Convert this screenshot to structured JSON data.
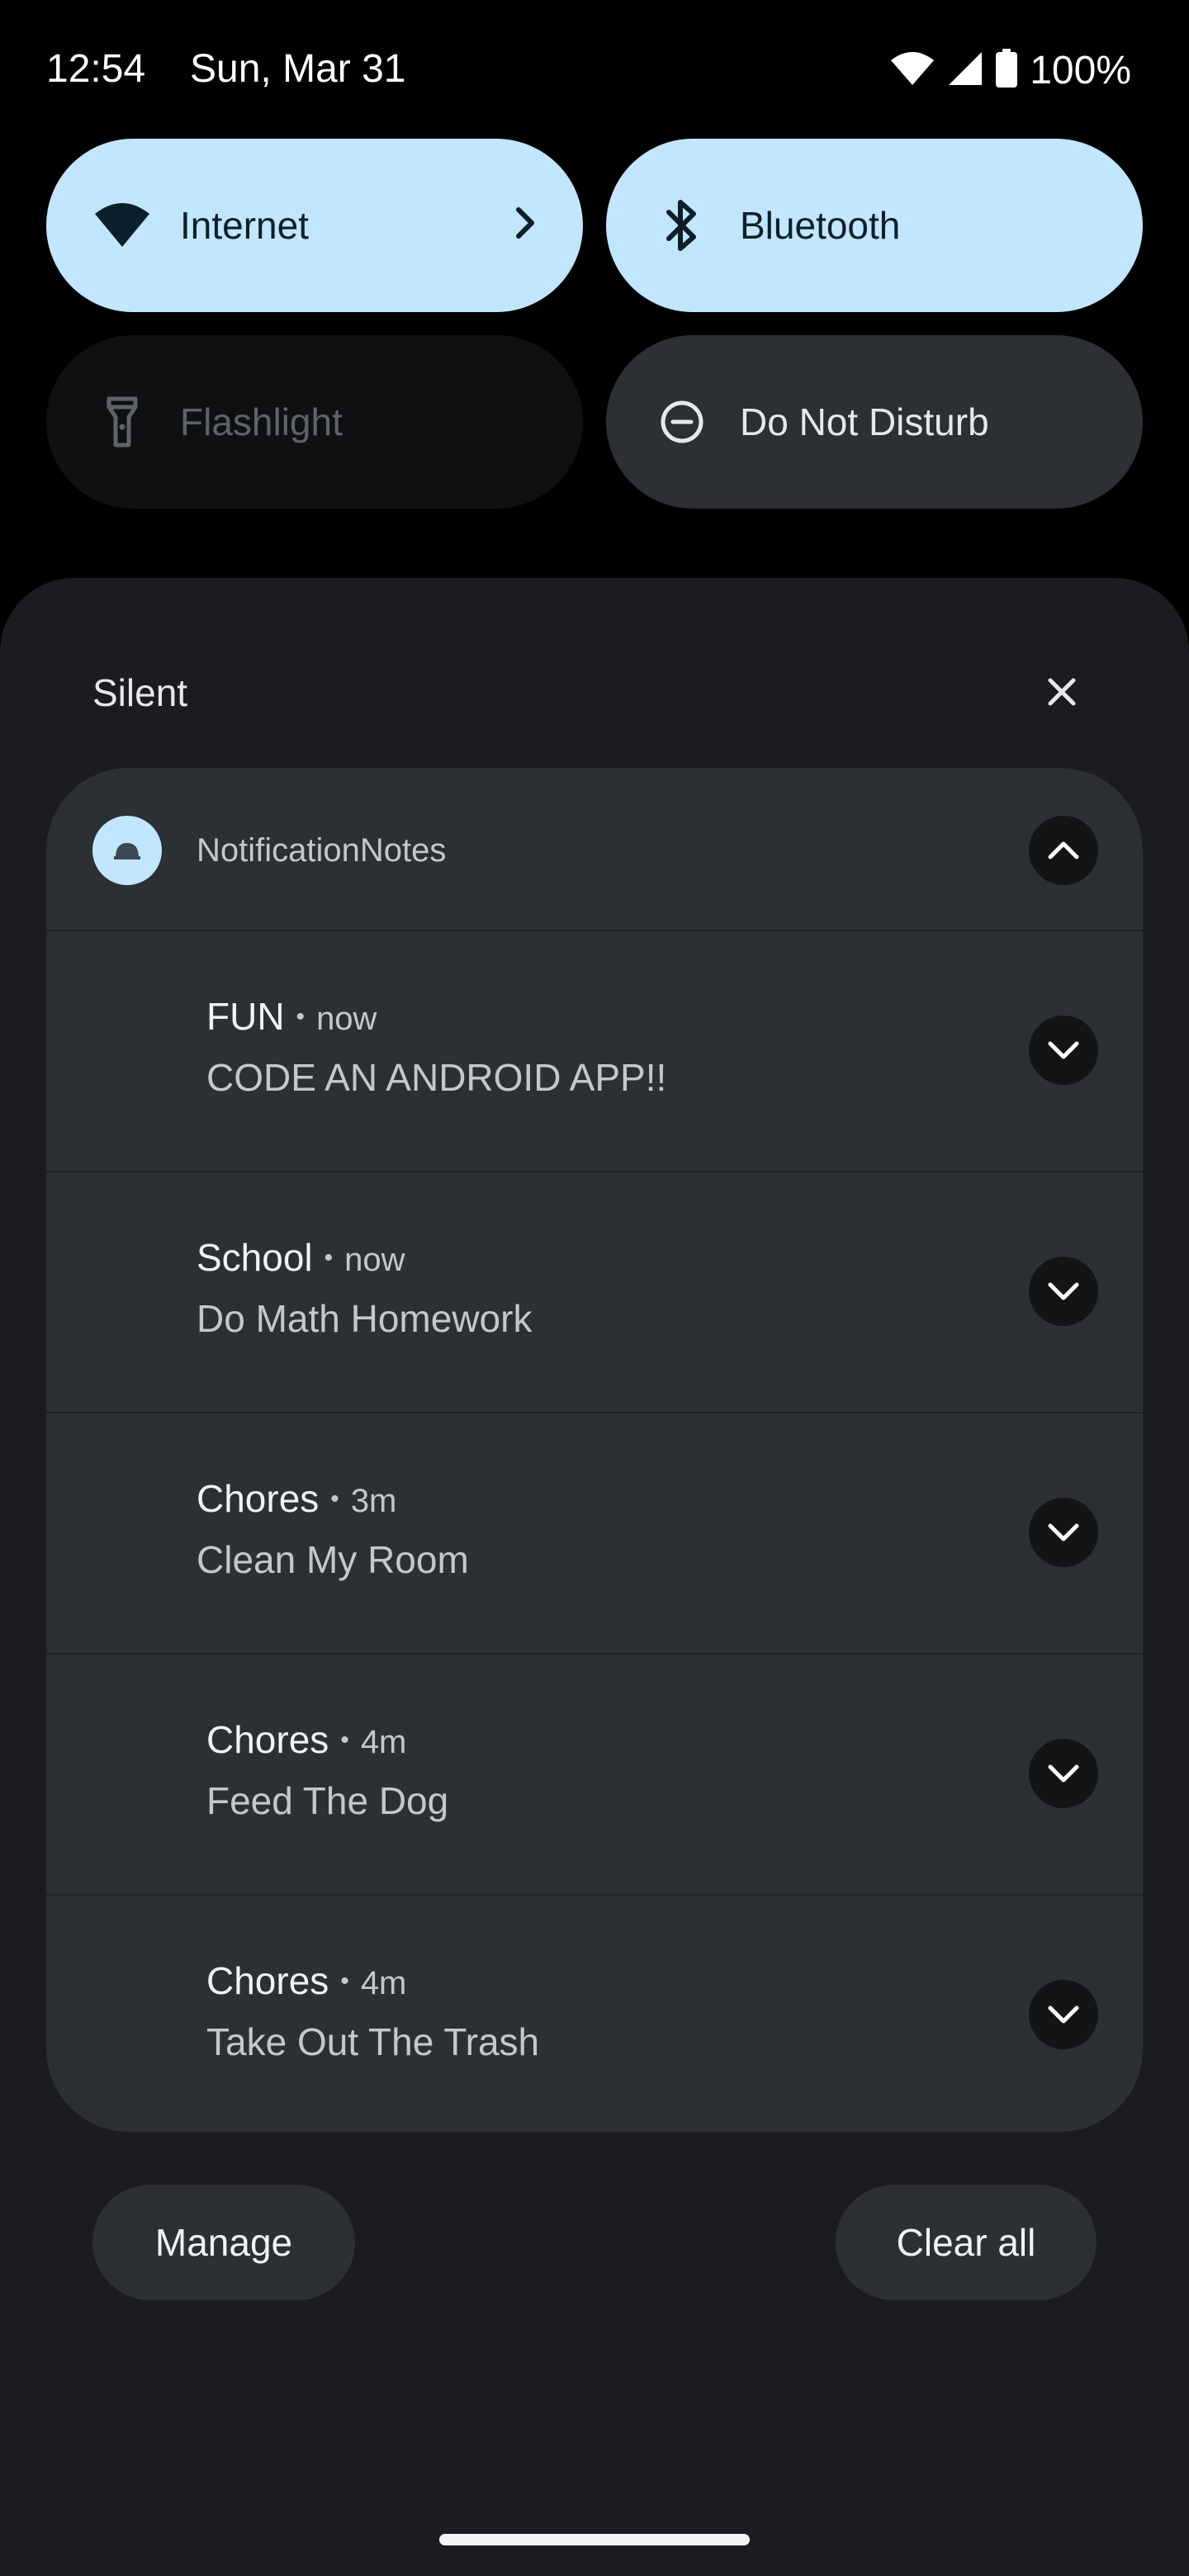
{
  "status_bar": {
    "time": "12:54",
    "date": "Sun, Mar 31",
    "battery": "100%",
    "icons": [
      "wifi-icon",
      "signal-icon",
      "battery-icon"
    ]
  },
  "quick_settings": {
    "tiles": [
      {
        "label": "Internet",
        "icon": "wifi-icon",
        "state": "on"
      },
      {
        "label": "Bluetooth",
        "icon": "bluetooth-icon",
        "state": "on"
      },
      {
        "label": "Flashlight",
        "icon": "flashlight-icon",
        "state": "unavailable"
      },
      {
        "label": "Do Not Disturb",
        "icon": "do-not-disturb-icon",
        "state": "off"
      }
    ]
  },
  "shade": {
    "section_title": "Silent",
    "group": {
      "app_name": "NotificationNotes",
      "notifications": [
        {
          "title": "FUN",
          "time": "now",
          "body": "CODE AN ANDROID APP!!"
        },
        {
          "title": "School",
          "time": "now",
          "body": "Do Math Homework"
        },
        {
          "title": "Chores",
          "time": "3m",
          "body": "Clean My Room"
        },
        {
          "title": "Chores",
          "time": "4m",
          "body": "Feed The Dog"
        },
        {
          "title": "Chores",
          "time": "4m",
          "body": "Take Out The Trash"
        }
      ]
    },
    "manage_label": "Manage",
    "clear_all_label": "Clear all"
  },
  "colors": {
    "tile_active": "#c2e6ff",
    "panel": "#1a1c1f",
    "card": "#2c2f33"
  }
}
